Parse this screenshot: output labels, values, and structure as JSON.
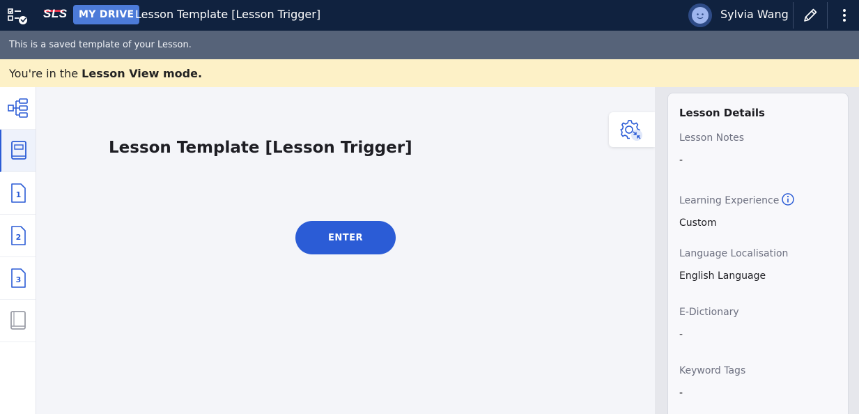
{
  "topbar": {
    "logo": "SLS",
    "badge": "MY DRIVE",
    "title": "Lesson Template [Lesson Trigger]",
    "user_name": "Sylvia Wang",
    "icons": [
      "app-checklist-icon",
      "avatar",
      "pencil-icon",
      "more-vertical-icon"
    ]
  },
  "info_strip": {
    "text": "This is a saved template of your Lesson."
  },
  "mode_banner": {
    "prefix": "You're in the ",
    "mode": "Lesson View mode."
  },
  "sidebar": {
    "items": [
      {
        "name": "lesson-map",
        "icon": "tree-map-icon"
      },
      {
        "name": "lesson-cover",
        "icon": "book-icon",
        "active": true
      },
      {
        "name": "section-1",
        "label": "1",
        "icon": "page-number-icon"
      },
      {
        "name": "section-2",
        "label": "2",
        "icon": "page-number-icon"
      },
      {
        "name": "section-3",
        "label": "3",
        "icon": "page-number-icon"
      },
      {
        "name": "lesson-end",
        "icon": "book-closed-icon"
      }
    ]
  },
  "main": {
    "lesson_title": "Lesson Template [Lesson Trigger]",
    "enter_label": "ENTER"
  },
  "details": {
    "title": "Lesson Details",
    "fields": [
      {
        "label": "Lesson Notes",
        "value": "-"
      },
      {
        "label": "Learning Experience",
        "value": "Custom"
      },
      {
        "label": "Language Localisation",
        "value": "English Language"
      },
      {
        "label": "E-Dictionary",
        "value": "-"
      },
      {
        "label": "Keyword Tags",
        "value": "-"
      }
    ]
  },
  "colors": {
    "topbar": "#10223f",
    "info_strip": "#566379",
    "banner": "#fdf1c7",
    "accent": "#2b5cd6",
    "brand_red": "#e8334a"
  }
}
